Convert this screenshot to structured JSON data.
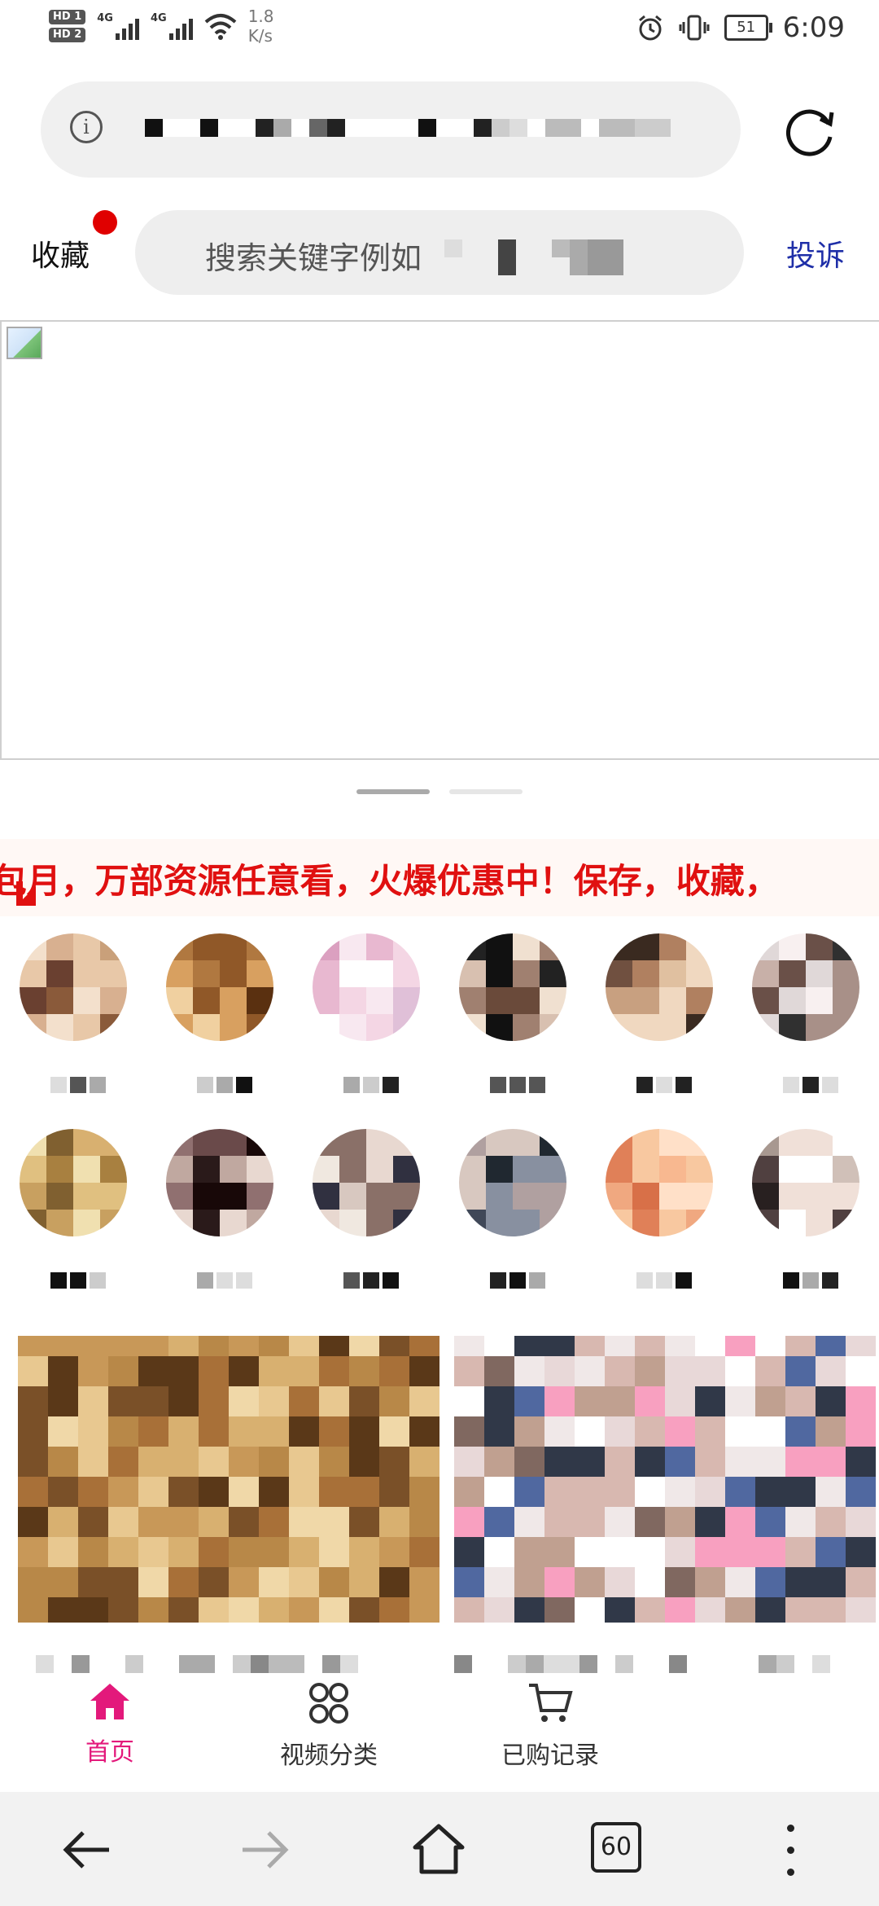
{
  "status_bar": {
    "hd_badges": [
      "HD 1",
      "HD 2"
    ],
    "network_labels": [
      "4G",
      "4G"
    ],
    "speed": "1.8",
    "speed_unit": "K/s",
    "battery": "51",
    "time": "6:09",
    "icons": [
      "alarm-icon",
      "vibrate-icon",
      "wifi-icon"
    ]
  },
  "browser": {
    "url_icon": "info-icon",
    "reload_icon": "reload-icon"
  },
  "header": {
    "favorites_label": "收藏",
    "search_placeholder": "搜索关键字例如",
    "complain_label": "投诉"
  },
  "marquee": {
    "text": "P包月，万部资源任意看，火爆优惠中！保存，收藏，"
  },
  "bottom_tabs": [
    {
      "label": "首页",
      "icon": "home-icon",
      "active": true
    },
    {
      "label": "视频分类",
      "icon": "category-icon",
      "active": false
    },
    {
      "label": "已购记录",
      "icon": "cart-icon",
      "active": false
    }
  ],
  "nav_bar": {
    "tab_count": "60",
    "icons": [
      "back-icon",
      "forward-icon",
      "home-outline-icon",
      "tab-count-icon",
      "more-menu-icon"
    ]
  },
  "colors": {
    "accent_pink": "#e3197b",
    "marquee_red": "#e01010",
    "complain_blue": "#1f2fa8",
    "notify_red": "#e00000"
  }
}
